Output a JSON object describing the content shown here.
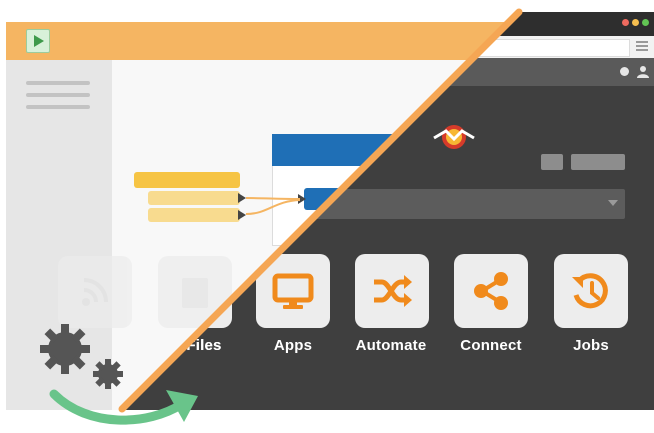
{
  "colors": {
    "orange_topbar": "#f5b562",
    "diagonal_stripe": "#f5a654",
    "dark_bg": "#3f3f3f",
    "icon_orange": "#f08a1c",
    "card_bg": "#ededed",
    "accent_blue": "#1f6fb6",
    "yellow_block": "#f6c444",
    "green_arrow": "#69c48a",
    "gear_gray": "#555555"
  },
  "left_pane": {
    "play_icon": "play-icon",
    "faded_labels": [
      "Files"
    ]
  },
  "apps": [
    {
      "label": "Files",
      "icon": "files-icon"
    },
    {
      "label": "Apps",
      "icon": "monitor-icon"
    },
    {
      "label": "Automate",
      "icon": "shuffle-icon"
    },
    {
      "label": "Connect",
      "icon": "share-icon"
    },
    {
      "label": "Jobs",
      "icon": "history-icon"
    }
  ]
}
